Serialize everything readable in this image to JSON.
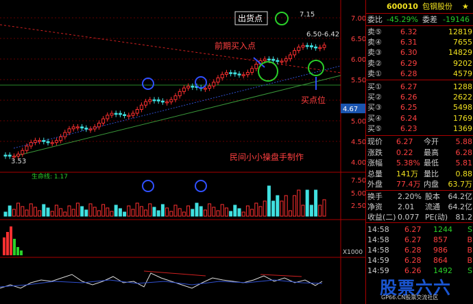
{
  "header": {
    "code": "600010",
    "name": "包钢股份"
  },
  "chart": {
    "price_axis": [
      "7.00",
      "6.50",
      "6.00",
      "5.50",
      "5.00",
      "4.50",
      "4.00"
    ],
    "current_price_tag": "4.67",
    "volume_axis": [
      "7.50",
      "5.00",
      "2.50"
    ],
    "multiplier": "X1000",
    "low_label": "3.53",
    "high_label": "7.15",
    "range_label": "6.50-6.42",
    "annotations": {
      "sell": "出货点",
      "prior_buy": "前期买入点",
      "buy": "买点位",
      "watermark": "民间小小操盘手制作",
      "lifeline": "生命线: 1.17"
    }
  },
  "quote": {
    "ratio": {
      "label": "委比",
      "value": "-45.29%",
      "diff_label": "委差",
      "diff": "-19146"
    },
    "sell": [
      {
        "label": "卖⑤",
        "price": "6.32",
        "vol": "12819"
      },
      {
        "label": "卖④",
        "price": "6.31",
        "vol": "7655"
      },
      {
        "label": "卖③",
        "price": "6.30",
        "vol": "14829"
      },
      {
        "label": "卖②",
        "price": "6.29",
        "vol": "9202"
      },
      {
        "label": "卖①",
        "price": "6.28",
        "vol": "4579"
      }
    ],
    "buy": [
      {
        "label": "买①",
        "price": "6.27",
        "vol": "1288"
      },
      {
        "label": "买②",
        "price": "6.26",
        "vol": "2622"
      },
      {
        "label": "买③",
        "price": "6.25",
        "vol": "5498"
      },
      {
        "label": "买④",
        "price": "6.24",
        "vol": "1769"
      },
      {
        "label": "买⑤",
        "price": "6.23",
        "vol": "1369"
      }
    ],
    "stats": [
      {
        "l1": "现价",
        "v1": "6.27",
        "l2": "今开",
        "v2": "5.88"
      },
      {
        "l1": "涨跌",
        "v1": "0.22",
        "l2": "最高",
        "v2": "6.28"
      },
      {
        "l1": "涨幅",
        "v1": "5.38%",
        "l2": "最低",
        "v2": "5.81"
      },
      {
        "l1": "总量",
        "v1": "141万",
        "l2": "量比",
        "v2": "0.88"
      },
      {
        "l1": "外盘",
        "v1": "77.4万",
        "l2": "内盘",
        "v2": "63.7万"
      }
    ],
    "stats2": [
      {
        "l1": "换手",
        "v1": "2.20%",
        "l2": "股本",
        "v2": "64.2亿"
      },
      {
        "l1": "净资",
        "v1": "2.01",
        "l2": "流通",
        "v2": "64.2亿"
      },
      {
        "l1": "收益(二)",
        "v1": "0.077",
        "l2": "PE(动)",
        "v2": "81.2"
      }
    ],
    "ticks": [
      {
        "time": "14:58",
        "price": "6.27",
        "vol": "1244",
        "dir": "S"
      },
      {
        "time": "14:58",
        "price": "6.27",
        "vol": "857",
        "dir": "B"
      },
      {
        "time": "14:58",
        "price": "6.28",
        "vol": "986",
        "dir": "B"
      },
      {
        "time": "14:59",
        "price": "6.28",
        "vol": "864",
        "dir": "B"
      },
      {
        "time": "14:59",
        "price": "6.26",
        "vol": "1492",
        "dir": "S"
      }
    ]
  },
  "brand": {
    "text": "股票六六",
    "site": "GP66.CN股票交流社区"
  }
}
